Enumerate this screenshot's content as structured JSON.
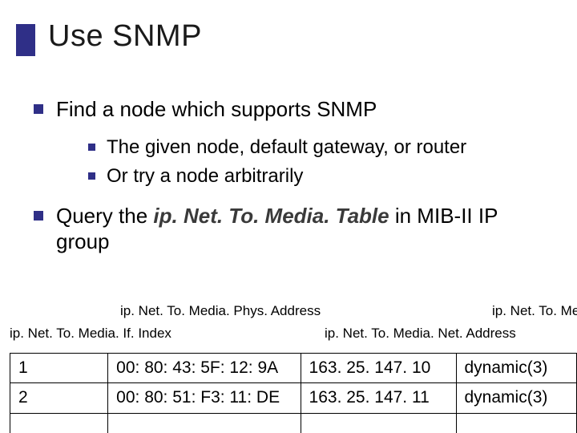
{
  "title": "Use SNMP",
  "bullets": {
    "l1_find": "Find a node which supports SNMP",
    "l2_given": "The given node, default gateway, or router",
    "l2_arbitrary": "Or try a node arbitrarily",
    "l1_query_pre": "Query the ",
    "l1_query_table": "ip. Net. To. Media. Table",
    "l1_query_post": " in MIB-II IP group"
  },
  "columns": {
    "ifIndex": "ip. Net. To. Media. If. Index",
    "phys": "ip. Net. To. Media. Phys. Address",
    "net": "ip. Net. To. Media. Net. Address",
    "type": "ip. Net. To. Media. Type"
  },
  "rows": [
    {
      "if": "1",
      "phys": "00: 80: 43: 5F: 12: 9A",
      "net": "163. 25. 147. 10",
      "type": "dynamic(3)"
    },
    {
      "if": "2",
      "phys": "00: 80: 51: F3: 11: DE",
      "net": "163. 25. 147. 11",
      "type": "dynamic(3)"
    }
  ]
}
